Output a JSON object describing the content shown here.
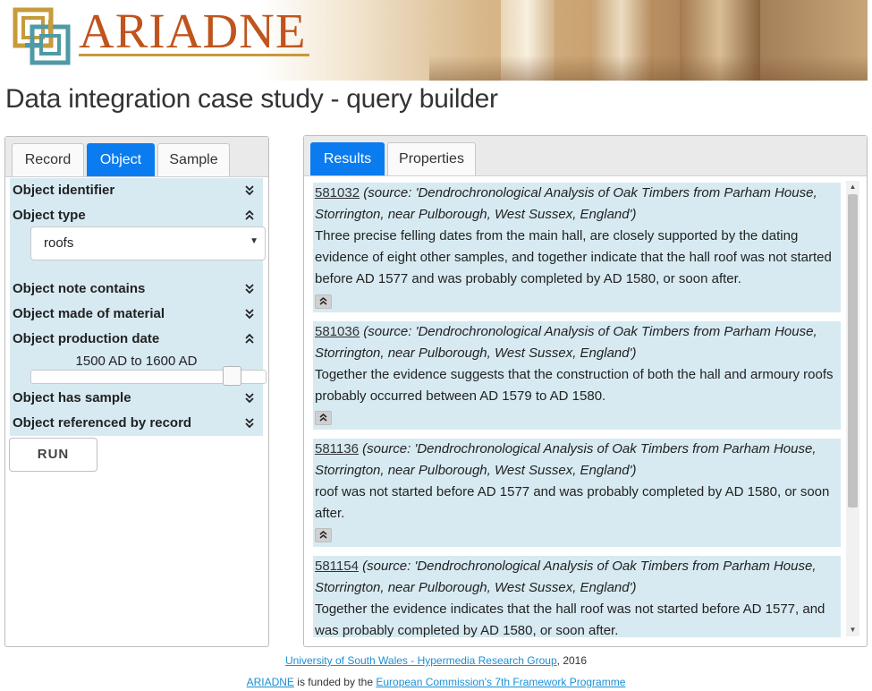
{
  "header": {
    "brand": "ARIADNE",
    "logo_icon": "ariadne-knot-logo",
    "accent": "#c0541d"
  },
  "page_title": "Data integration case study - query builder",
  "left_tabs": [
    {
      "label": "Record"
    },
    {
      "label": "Object",
      "active": true
    },
    {
      "label": "Sample"
    }
  ],
  "filters": {
    "object_identifier": "Object identifier",
    "object_type": "Object type",
    "object_type_value": "roofs",
    "object_note": "Object note contains",
    "object_material": "Object made of material",
    "object_date": "Object production date",
    "date_range": "1500 AD to 1600 AD",
    "slider_position": 0.9,
    "object_sample": "Object has sample",
    "object_referenced": "Object referenced by record"
  },
  "run_label": "RUN",
  "right_tabs": [
    {
      "label": "Results",
      "active": true
    },
    {
      "label": "Properties"
    }
  ],
  "results": [
    {
      "id": "581032",
      "source": "(source: 'Dendrochronological Analysis of Oak Timbers from Parham House, Storrington, near Pulborough, West Sussex, England')",
      "text": "Three precise felling dates from the main hall, are closely supported by the dating evidence of eight other samples, and together indicate that the hall roof was not started before AD 1577 and was probably completed by AD 1580, or soon after."
    },
    {
      "id": "581036",
      "source": "(source: 'Dendrochronological Analysis of Oak Timbers from Parham House, Storrington, near Pulborough, West Sussex, England')",
      "text": "Together the evidence suggests that the construction of both the hall and armoury roofs probably occurred between AD 1579 to AD 1580."
    },
    {
      "id": "581136",
      "source": "(source: 'Dendrochronological Analysis of Oak Timbers from Parham House, Storrington, near Pulborough, West Sussex, England')",
      "text": "roof was not started before AD 1577 and was probably completed by AD 1580, or soon after."
    },
    {
      "id": "581154",
      "source": "(source: 'Dendrochronological Analysis of Oak Timbers from Parham House, Storrington, near Pulborough, West Sussex, England')",
      "text": "Together the evidence indicates that the hall roof was not started before AD 1577, and was probably completed by AD 1580, or soon after."
    }
  ],
  "footer": {
    "line1_link": "University of South Wales - Hypermedia Research Group",
    "line1_suffix": ", 2016",
    "line2_link1": "ARIADNE",
    "line2_middle": " is funded by the ",
    "line2_link2": "European Commission's 7th Framework Programme"
  }
}
